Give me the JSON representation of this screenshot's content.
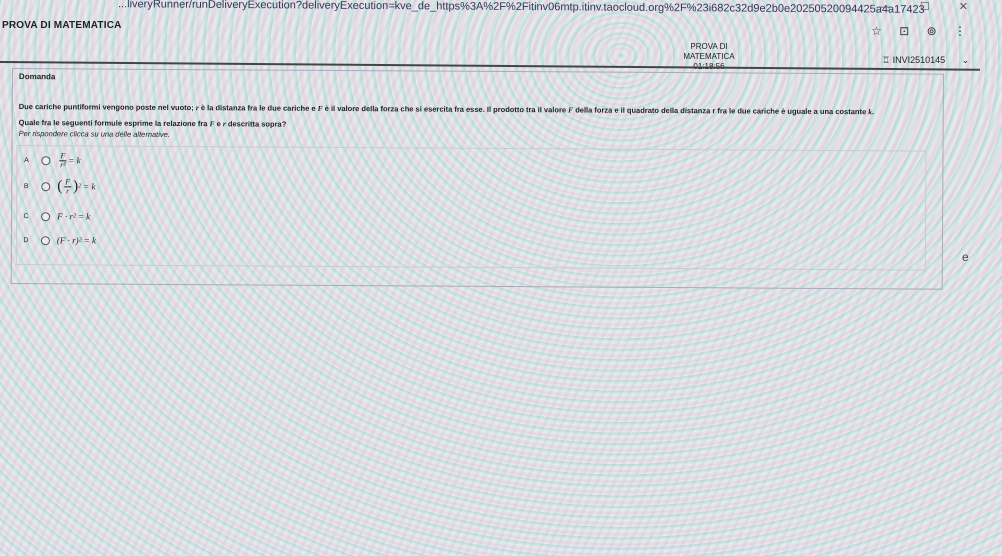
{
  "browser": {
    "url": "...liveryRunner/runDeliveryExecution?deliveryExecution=kve_de_https%3A%2F%2Fitinv06mtp.itinv.taocloud.org%2F%23i682c32d9e2b0e20250520094425a4a17423",
    "window_controls": [
      "—",
      "☐",
      "✕"
    ],
    "toolbar_icons": [
      "☆",
      "⊡",
      "⊚",
      "⋮"
    ]
  },
  "app": {
    "title": "PROVA DI MATEMATICA",
    "header_title": "PROVA DI MATEMATICA",
    "timer": "01:18:56",
    "user_id": "INVI2510145",
    "user_icon": "♖",
    "chevron": "⌄"
  },
  "question": {
    "heading": "Domanda",
    "intro_a": "Due cariche puntiformi vengono poste nel vuoto; ",
    "var_r1": "r",
    "intro_b": " è la distanza fra le due cariche e ",
    "var_F1": "F",
    "intro_c": " è il valore della forza che si esercita fra esse. Il prodotto tra il valore ",
    "var_F2": "F",
    "intro_d": " della forza e il quadrato della distanza r fra le due cariche è uguale a una costante ",
    "var_k": "k",
    "intro_e": ".",
    "ask_a": "Quale fra le seguenti formule esprime la relazione fra ",
    "ask_F": "F",
    "ask_b": " e ",
    "ask_r": "r",
    "ask_c": " descritta sopra?",
    "instruction": "Per rispondere clicca su una delle alternative."
  },
  "choices": [
    {
      "letter": "A",
      "num": "F",
      "den": "r²",
      "rhs": "= k"
    },
    {
      "letter": "B",
      "num": "F",
      "den": "r",
      "exp": "2",
      "rhs": "= k"
    },
    {
      "letter": "C",
      "lhs": "F · r",
      "exp": "2",
      "rhs": "= k"
    },
    {
      "letter": "D",
      "lhs": "(F · r)",
      "exp": "2",
      "rhs": "= k"
    }
  ],
  "edge_text": "e"
}
